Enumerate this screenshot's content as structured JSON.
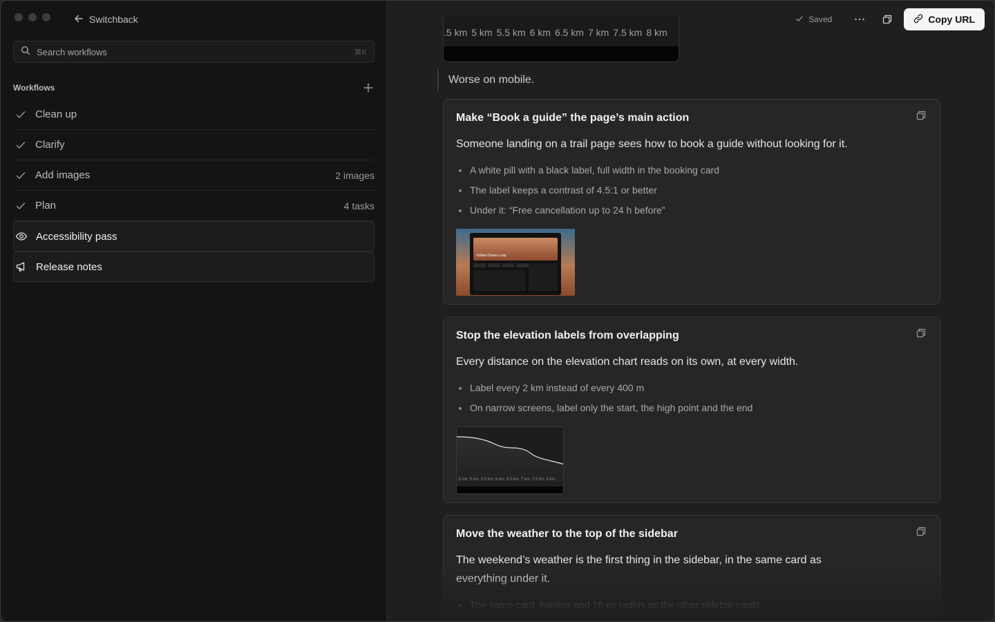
{
  "nav": {
    "back_label": "Switchback"
  },
  "search": {
    "placeholder": "Search workflows",
    "shortcut": "⌘K"
  },
  "workflows": {
    "title": "Workflows",
    "items": [
      {
        "label": "Clean up",
        "meta": "",
        "icon": "check-icon"
      },
      {
        "label": "Clarify",
        "meta": "",
        "icon": "check-icon"
      },
      {
        "label": "Add images",
        "meta": "2 images",
        "icon": "check-icon"
      },
      {
        "label": "Plan",
        "meta": "4 tasks",
        "icon": "check-icon"
      },
      {
        "label": "Accessibility pass",
        "meta": "",
        "icon": "eye-icon"
      },
      {
        "label": "Release notes",
        "meta": "",
        "icon": "megaphone-icon"
      }
    ]
  },
  "toolbar": {
    "saved_label": "Saved",
    "copy_url_label": "Copy URL"
  },
  "content": {
    "chart_ticks": [
      ".5 km",
      "5 km",
      "5.5 km",
      "6 km",
      "6.5 km",
      "7 km",
      "7.5 km",
      "8 km"
    ],
    "quote": "Worse on mobile.",
    "cards": [
      {
        "title": "Make “Book a guide” the page’s main action",
        "lead": "Someone landing on a trail page sees how to book a guide without looking for it.",
        "bullets": [
          "A white pill with a black label, full width in the booking card",
          "The label keeps a contrast of 4.5:1 or better",
          "Under it: “Free cancellation up to 24 h before”"
        ],
        "thumb_text": "Hollow Dunes Loop"
      },
      {
        "title": "Stop the elevation labels from overlapping",
        "lead": "Every distance on the elevation chart reads on its own, at every width.",
        "bullets": [
          "Label every 2 km instead of every 400 m",
          "On narrow screens, label only the start, the high point and the end"
        ],
        "thumb_ticks": [
          ".5 km",
          "5 km",
          "5.5 km",
          "6 km",
          "6.5 km",
          "7 km",
          "7.5 km",
          "8 km"
        ]
      },
      {
        "title": "Move the weather to the top of the sidebar",
        "lead": "The weekend’s weather is the first thing in the sidebar, in the same card as everything under it.",
        "bullets": [
          "The same card, hairline and 16 px radius as the other sidebar cards"
        ]
      }
    ]
  },
  "colors": {
    "accent_button": "#f5f5f5",
    "background": "#1f1f1f",
    "sidebar": "#141414"
  }
}
